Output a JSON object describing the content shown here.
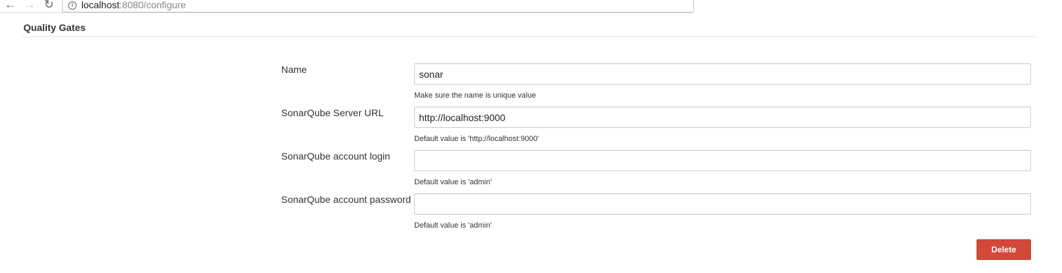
{
  "browser": {
    "url_host": "localhost",
    "url_rest": ":8080/configure",
    "back_icon": "←",
    "forward_icon": "→",
    "reload_icon": "↻",
    "info_icon": "i"
  },
  "section": {
    "title": "Quality Gates"
  },
  "form": {
    "name": {
      "label": "Name",
      "value": "sonar",
      "help": "Make sure the name is unique value"
    },
    "server_url": {
      "label": "SonarQube Server URL",
      "value": "http://localhost:9000",
      "help": "Default value is 'http://localhost:9000'"
    },
    "account_login": {
      "label": "SonarQube account login",
      "value": "",
      "help": "Default value is 'admin'"
    },
    "account_password": {
      "label": "SonarQube account password",
      "value": "",
      "help": "Default value is 'admin'"
    },
    "delete_label": "Delete"
  },
  "colors": {
    "delete_button": "#d24939",
    "text": "#333333",
    "input_border": "#cccccc"
  }
}
